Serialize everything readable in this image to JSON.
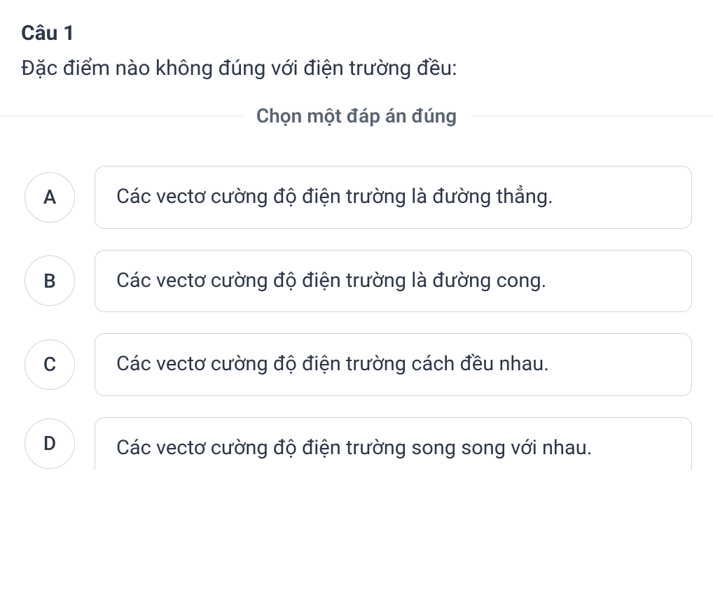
{
  "question": {
    "number_label": "Câu 1",
    "text": "Đặc điểm nào không đúng với điện trường đều:",
    "instruction": "Chọn một đáp án đúng"
  },
  "options": [
    {
      "letter": "A",
      "text": "Các vectơ cường độ điện trường là đường thẳng."
    },
    {
      "letter": "B",
      "text": "Các vectơ cường độ điện trường là đường cong."
    },
    {
      "letter": "C",
      "text": "Các vectơ cường độ điện trường cách đều nhau."
    },
    {
      "letter": "D",
      "text": "Các vectơ cường độ điện trường song song với nhau."
    }
  ]
}
